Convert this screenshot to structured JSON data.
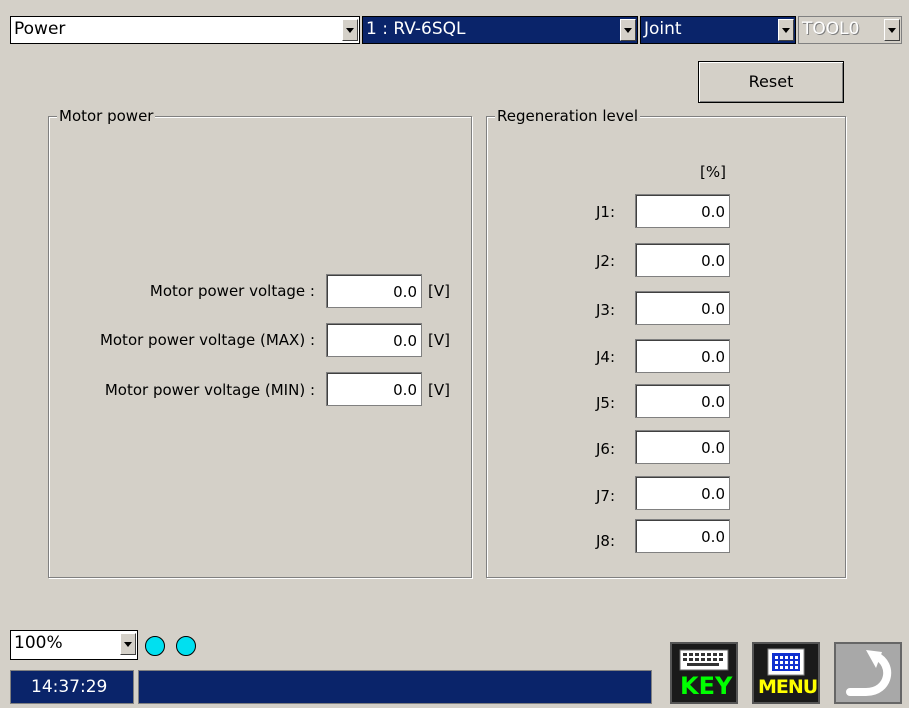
{
  "top_bar": {
    "screen_select": "Power",
    "robot_select": "1 : RV-6SQL",
    "coord_select": "Joint",
    "tool_select": "TOOL0"
  },
  "reset_label": "Reset",
  "motor_power": {
    "title": "Motor power",
    "rows": [
      {
        "label": "Motor power voltage :",
        "value": "0.0",
        "unit": "[V]"
      },
      {
        "label": "Motor power voltage (MAX) :",
        "value": "0.0",
        "unit": "[V]"
      },
      {
        "label": "Motor power voltage (MIN) :",
        "value": "0.0",
        "unit": "[V]"
      }
    ]
  },
  "regeneration": {
    "title": "Regeneration level",
    "unit": "[%]",
    "joints": [
      {
        "label": "J1:",
        "value": "0.0"
      },
      {
        "label": "J2:",
        "value": "0.0"
      },
      {
        "label": "J3:",
        "value": "0.0"
      },
      {
        "label": "J4:",
        "value": "0.0"
      },
      {
        "label": "J5:",
        "value": "0.0"
      },
      {
        "label": "J6:",
        "value": "0.0"
      },
      {
        "label": "J7:",
        "value": "0.0"
      },
      {
        "label": "J8:",
        "value": "0.0"
      }
    ]
  },
  "status": {
    "speed": "100%",
    "time": "14:37:29",
    "message": ""
  },
  "buttons": {
    "key_label": "KEY",
    "menu_label": "MENU"
  },
  "colors": {
    "background": "#d4d0c8",
    "title_blue": "#0a246a",
    "indicator": "#00e0f0",
    "key_text": "#00ff00",
    "menu_text": "#ffff00"
  }
}
